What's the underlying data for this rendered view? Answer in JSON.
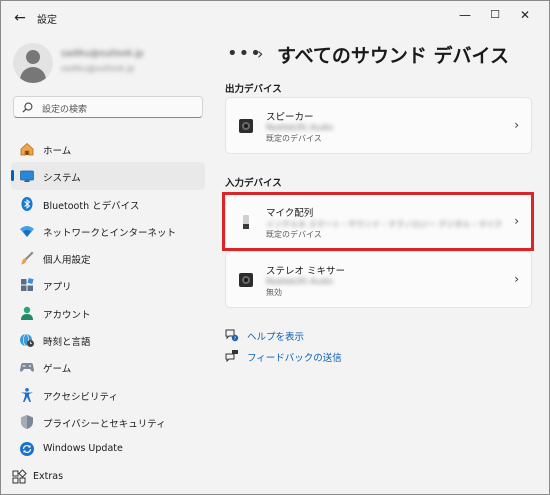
{
  "window": {
    "title": "設定",
    "back_icon": "back-arrow-icon",
    "minimize_glyph": "—",
    "maximize_glyph": "☐",
    "close_glyph": "✕"
  },
  "profile": {
    "name": "sadiku@outlook.jp",
    "account": "sadiku@outlook.jp"
  },
  "search": {
    "placeholder": "設定の検索"
  },
  "sidebar": {
    "items": [
      {
        "label": "ホーム",
        "icon": "home-icon"
      },
      {
        "label": "システム",
        "icon": "system-monitor-icon",
        "active": true
      },
      {
        "label": "Bluetooth とデバイス",
        "icon": "bluetooth-icon"
      },
      {
        "label": "ネットワークとインターネット",
        "icon": "wifi-icon"
      },
      {
        "label": "個人用設定",
        "icon": "paintbrush-icon"
      },
      {
        "label": "アプリ",
        "icon": "apps-icon"
      },
      {
        "label": "アカウント",
        "icon": "account-icon"
      },
      {
        "label": "時刻と言語",
        "icon": "globe-clock-icon"
      },
      {
        "label": "ゲーム",
        "icon": "gamepad-icon"
      },
      {
        "label": "アクセシビリティ",
        "icon": "accessibility-icon"
      },
      {
        "label": "プライバシーとセキュリティ",
        "icon": "shield-icon"
      },
      {
        "label": "Windows Update",
        "icon": "windows-update-icon"
      }
    ],
    "extras": {
      "label": "Extras",
      "icon": "extras-icon"
    }
  },
  "breadcrumb": {
    "more": "•••",
    "separator": "›",
    "title": "すべてのサウンド デバイス"
  },
  "output_section": {
    "title": "出力デバイス",
    "devices": [
      {
        "name": "スピーカー",
        "detail": "Realtek(R) Audio",
        "status": "既定のデバイス",
        "icon": "speaker-icon"
      }
    ]
  },
  "input_section": {
    "title": "入力デバイス",
    "devices": [
      {
        "name": "マイク配列",
        "detail": "インテル® スマート・サウンド・テクノロジー デジタル・マイク",
        "status": "既定のデバイス",
        "icon": "microphone-icon",
        "highlighted": true
      },
      {
        "name": "ステレオ ミキサー",
        "detail": "Realtek(R) Audio",
        "status": "無効",
        "icon": "speaker-icon"
      }
    ]
  },
  "links": [
    {
      "label": "ヘルプを表示",
      "icon": "help-icon"
    },
    {
      "label": "フィードバックの送信",
      "icon": "feedback-icon"
    }
  ],
  "colors": {
    "accent": "#005fb8",
    "highlight": "#d9262b",
    "link": "#0b5fb5"
  }
}
